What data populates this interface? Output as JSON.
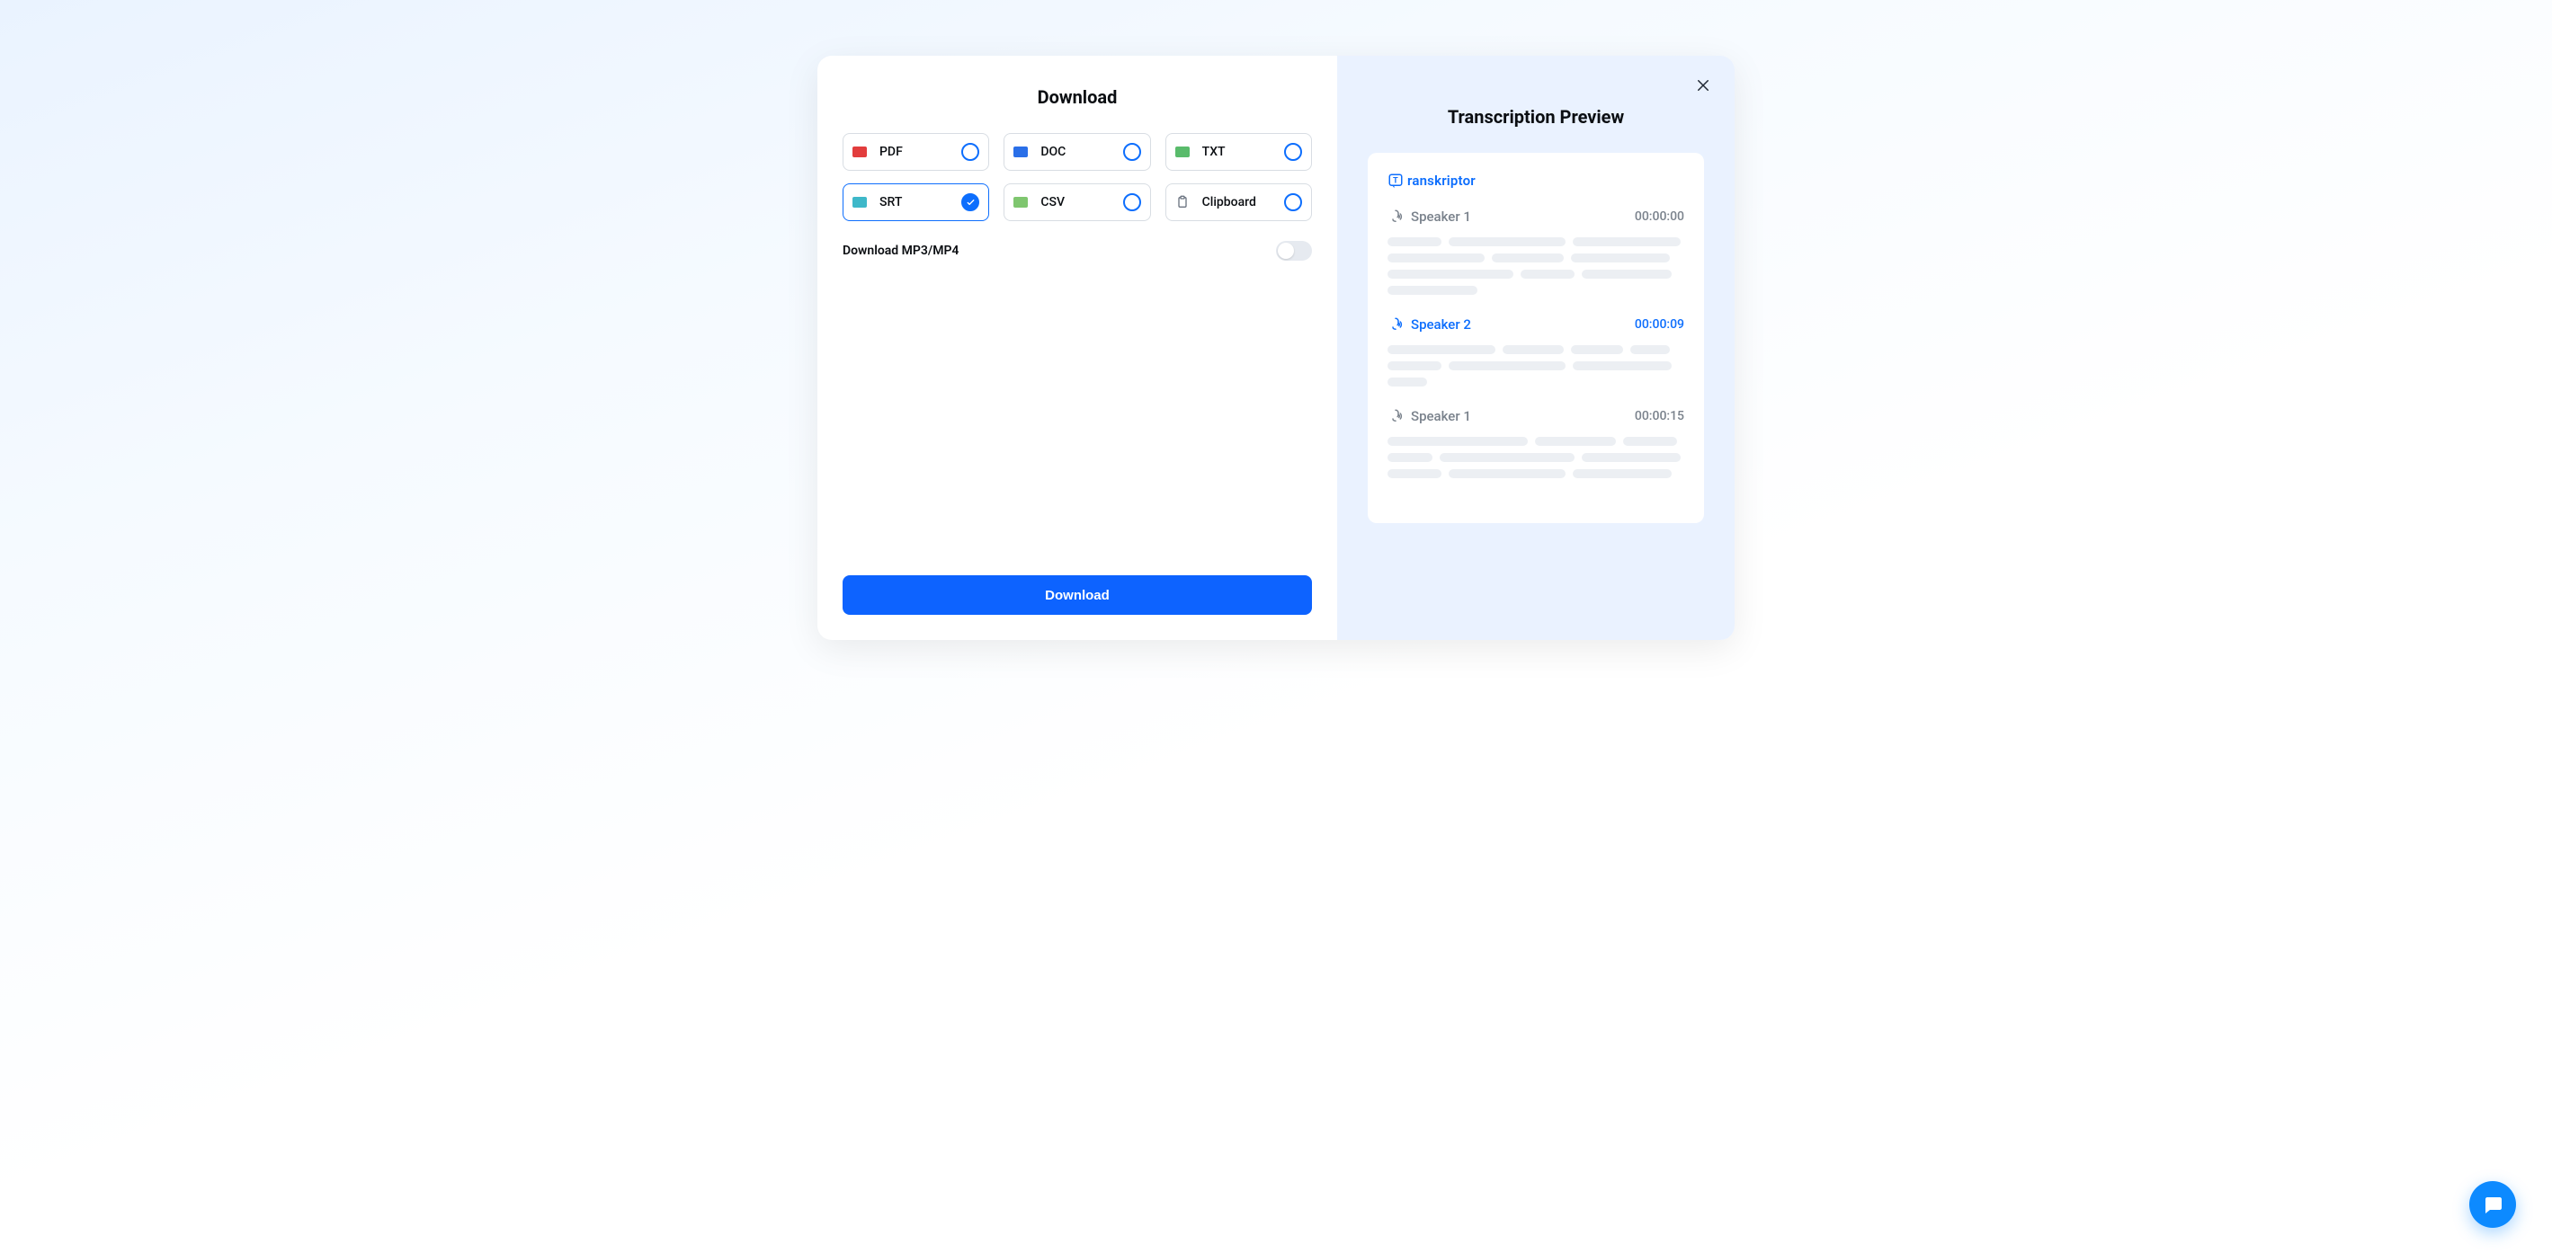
{
  "modal": {
    "left": {
      "title": "Download",
      "formats": [
        {
          "key": "pdf",
          "label": "PDF",
          "selected": false,
          "badge_bg": "#e23d3d"
        },
        {
          "key": "doc",
          "label": "DOC",
          "selected": false,
          "badge_bg": "#2a6fe8"
        },
        {
          "key": "txt",
          "label": "TXT",
          "selected": false,
          "badge_bg": "#59bb6b"
        },
        {
          "key": "srt",
          "label": "SRT",
          "selected": true,
          "badge_bg": "#3eb8c9"
        },
        {
          "key": "csv",
          "label": "CSV",
          "selected": false,
          "badge_bg": "#7fc66f"
        },
        {
          "key": "clipboard",
          "label": "Clipboard",
          "selected": false,
          "badge_bg": ""
        }
      ],
      "mp3_label": "Download MP3/MP4",
      "mp3_toggle": false,
      "download_button": "Download"
    },
    "right": {
      "title": "Transcription Preview",
      "brand": "ranskriptor",
      "brand_prefix": "T",
      "segments": [
        {
          "speaker": "Speaker 1",
          "time": "00:00:00",
          "accent": "gray",
          "bars": [
            60,
            130,
            120,
            108,
            80,
            110,
            140,
            60,
            100,
            100
          ]
        },
        {
          "speaker": "Speaker 2",
          "time": "00:00:09",
          "accent": "blue",
          "bars": [
            120,
            68,
            58,
            44,
            60,
            130,
            110,
            44
          ]
        },
        {
          "speaker": "Speaker 1",
          "time": "00:00:15",
          "accent": "gray",
          "bars": [
            156,
            90,
            60,
            50,
            150,
            110,
            60,
            130,
            110
          ]
        }
      ]
    }
  },
  "icons": {
    "close": "close-icon",
    "speaker": "speaker-icon",
    "chat": "chat-icon",
    "clipboard": "clipboard-icon",
    "check": "check-icon"
  }
}
